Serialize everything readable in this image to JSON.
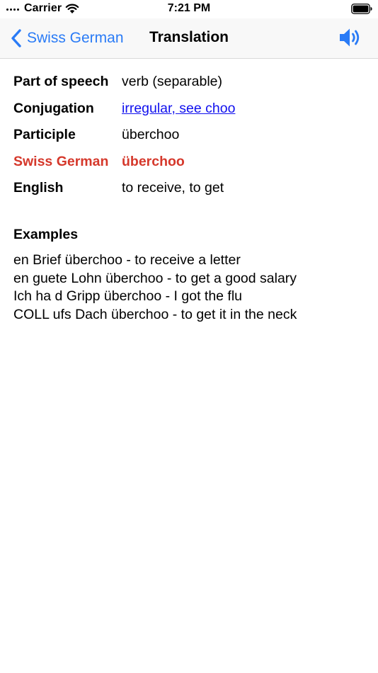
{
  "status_bar": {
    "carrier": "Carrier",
    "time": "7:21 PM"
  },
  "nav_bar": {
    "back_label": "Swiss German",
    "title": "Translation",
    "accent_color": "#2a7bf6"
  },
  "details": {
    "part_of_speech": {
      "label": "Part of speech",
      "value": "verb (separable)"
    },
    "conjugation": {
      "label": "Conjugation",
      "value": "irregular, see choo"
    },
    "participle": {
      "label": "Participle",
      "value": "überchoo"
    },
    "swiss_german": {
      "label": "Swiss German",
      "value": "überchoo",
      "color": "#d5382b"
    },
    "english": {
      "label": "English",
      "value": "to receive, to get"
    }
  },
  "examples": {
    "heading": "Examples",
    "items": [
      "en Brief überchoo - to receive a letter",
      "en guete Lohn überchoo - to get a good salary",
      "Ich ha d Gripp überchoo - I got the flu",
      "COLL ufs Dach überchoo - to get it in the neck"
    ]
  },
  "icons": {
    "back": "chevron-left-icon",
    "speaker": "speaker-icon",
    "wifi": "wifi-icon",
    "battery": "battery-icon"
  }
}
